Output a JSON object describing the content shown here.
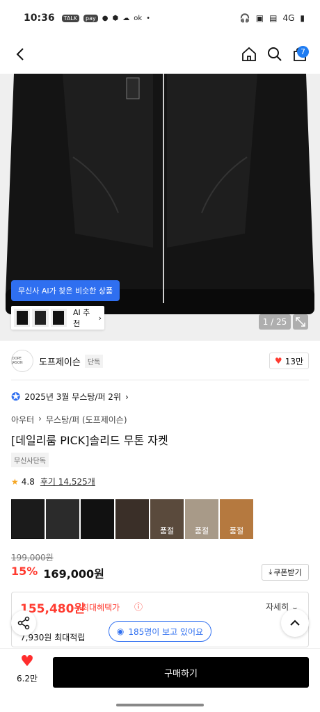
{
  "status_bar": {
    "time": "10:36",
    "left_icons": [
      "TALK",
      "pay",
      "wallet",
      "shield",
      "leaf",
      "ok"
    ],
    "network": "4G"
  },
  "nav": {
    "back_icon": "chevron-left-icon",
    "home_icon": "home-icon",
    "search_icon": "search-icon",
    "cart_icon": "shopping-bag-icon",
    "cart_count": "7"
  },
  "hero": {
    "ai_bubble": "무신사 AI가 찾은 비슷한 상품",
    "ai_button": "AI 추천",
    "counter": "1 / 25"
  },
  "brand": {
    "logo_text": "DOPE JASON",
    "name": "도프제이슨",
    "tag": "단독",
    "likes": "13만"
  },
  "product": {
    "rank": "2025년 3월 무스탕/퍼 2위",
    "breadcrumb": [
      "아우터",
      "무스탕/퍼 (도프제이슨)"
    ],
    "title": "[데일리룸 PICK]솔리드 무톤 자켓",
    "exclusive_tag": "무신사단독",
    "rating": "4.8",
    "reviews": "후기 14,525개",
    "swatches": [
      {
        "color": "#1b1b1b",
        "soldout": ""
      },
      {
        "color": "#2b2b2b",
        "soldout": ""
      },
      {
        "color": "#111111",
        "soldout": ""
      },
      {
        "color": "#3a2f28",
        "soldout": ""
      },
      {
        "color": "#5a4a3c",
        "soldout": "품절"
      },
      {
        "color": "#a89a88",
        "soldout": "품절"
      },
      {
        "color": "#b5793f",
        "soldout": "품절"
      }
    ],
    "original_price": "199,000원",
    "discount": "15%",
    "price": "169,000원",
    "coupon": "쿠폰받기"
  },
  "benefit": {
    "price": "155,480원",
    "label": "최대혜택가",
    "more": "자세히",
    "points": "7,930원 최대적립"
  },
  "viewers": "185명이 보고 있어요",
  "bottom": {
    "fav_count": "6.2만",
    "buy": "구매하기"
  },
  "colors": {
    "accent_blue": "#2f6ff0",
    "sale_red": "#ff3b30",
    "buy_black": "#000000"
  }
}
